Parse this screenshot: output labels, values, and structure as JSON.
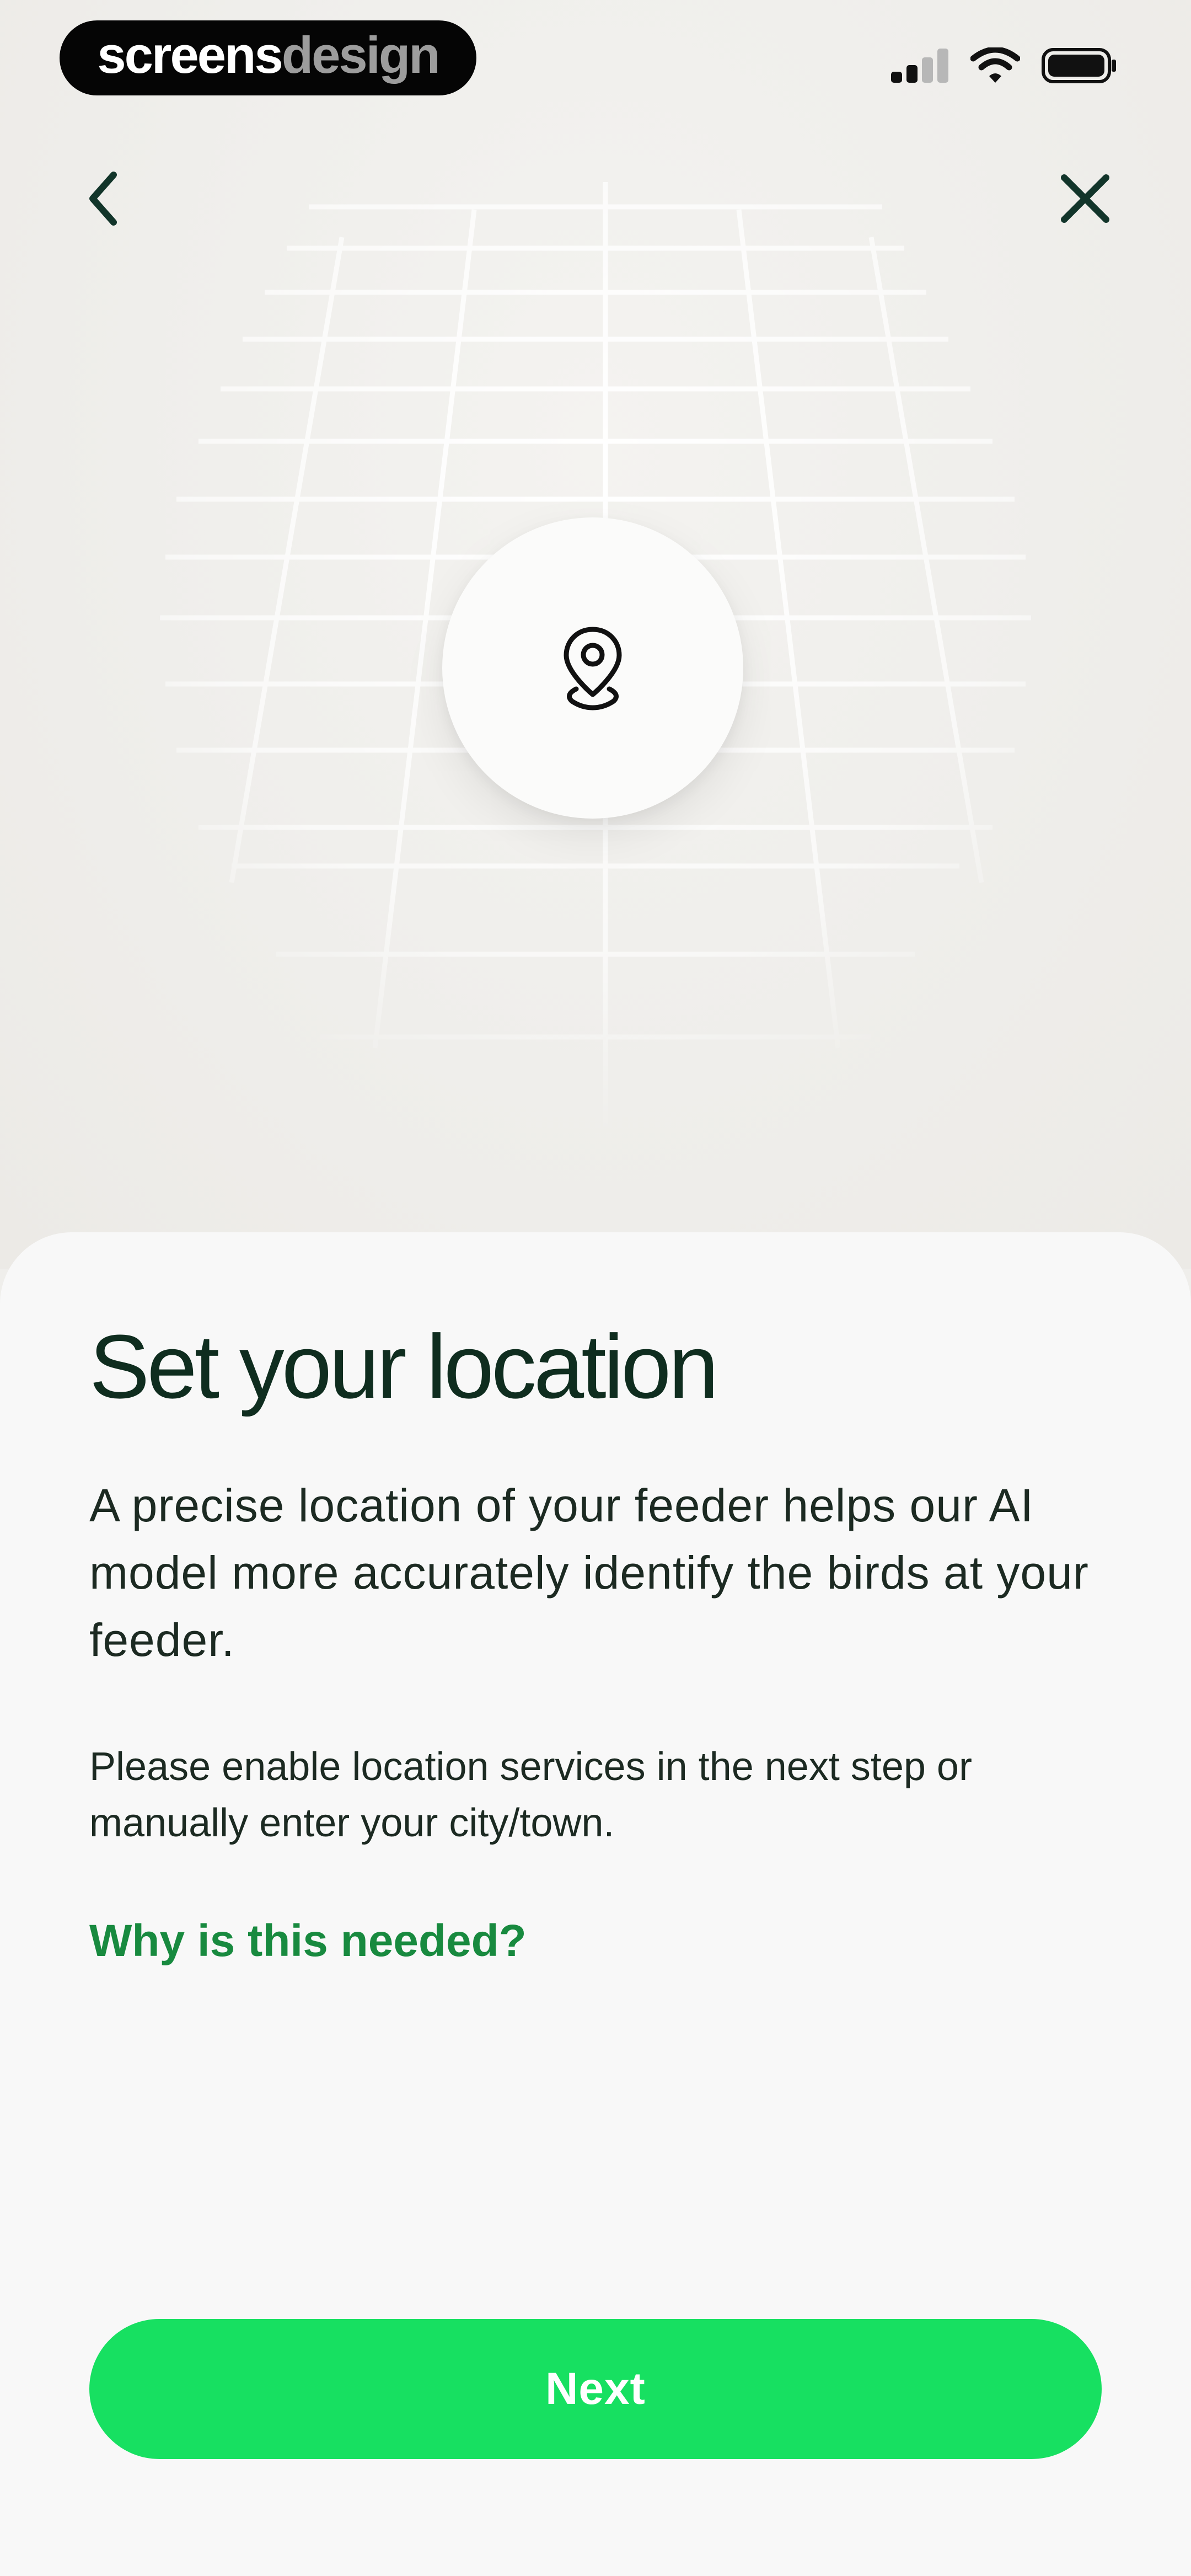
{
  "status_bar": {
    "watermark_part1": "screens",
    "watermark_part2": "design",
    "icons": [
      "cellular-signal-icon",
      "wifi-icon",
      "battery-icon"
    ]
  },
  "nav": {
    "back_icon": "chevron-left-icon",
    "close_icon": "close-icon"
  },
  "hero": {
    "icon": "location-pin-icon"
  },
  "content": {
    "title": "Set your location",
    "body": "A precise location of your feeder helps our AI model more accurately identify the birds at your feeder.",
    "hint": "Please enable location services in the next step or manually enter your city/town.",
    "why_link": "Why is this needed?"
  },
  "footer": {
    "next_label": "Next"
  },
  "colors": {
    "background": "#efeeeb",
    "sheet": "#f8f8f8",
    "title": "#0f2d1f",
    "link": "#188a3f",
    "primary_button": "#17e061"
  }
}
